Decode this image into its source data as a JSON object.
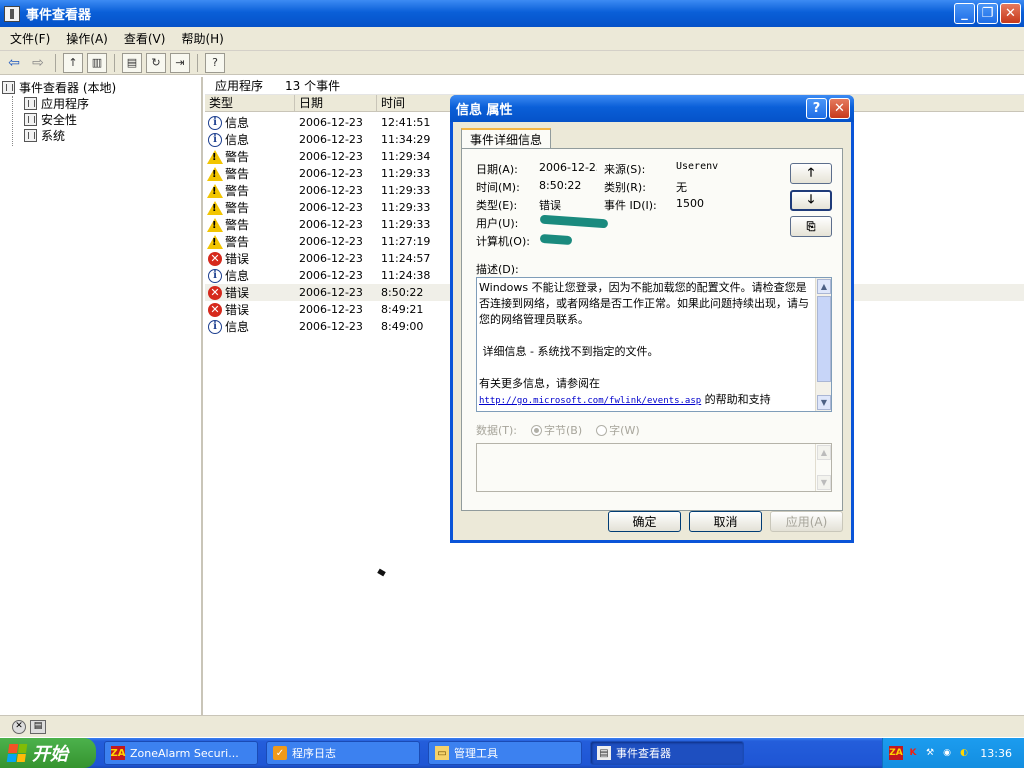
{
  "window": {
    "title": "事件查看器"
  },
  "menu": [
    "文件(F)",
    "操作(A)",
    "查看(V)",
    "帮助(H)"
  ],
  "tree": {
    "root": "事件查看器 (本地)",
    "children": [
      "应用程序",
      "安全性",
      "系统"
    ]
  },
  "list": {
    "header_name": "应用程序",
    "header_count": "13 个事件",
    "columns": [
      "类型",
      "日期",
      "时间"
    ],
    "rows": [
      {
        "type": "信息",
        "icon": "info-icon",
        "date": "2006-12-23",
        "time": "12:41:51"
      },
      {
        "type": "信息",
        "icon": "info-icon",
        "date": "2006-12-23",
        "time": "11:34:29"
      },
      {
        "type": "警告",
        "icon": "warning-icon",
        "date": "2006-12-23",
        "time": "11:29:34"
      },
      {
        "type": "警告",
        "icon": "warning-icon",
        "date": "2006-12-23",
        "time": "11:29:33"
      },
      {
        "type": "警告",
        "icon": "warning-icon",
        "date": "2006-12-23",
        "time": "11:29:33"
      },
      {
        "type": "警告",
        "icon": "warning-icon",
        "date": "2006-12-23",
        "time": "11:29:33"
      },
      {
        "type": "警告",
        "icon": "warning-icon",
        "date": "2006-12-23",
        "time": "11:29:33"
      },
      {
        "type": "警告",
        "icon": "warning-icon",
        "date": "2006-12-23",
        "time": "11:27:19"
      },
      {
        "type": "错误",
        "icon": "error-icon",
        "date": "2006-12-23",
        "time": "11:24:57"
      },
      {
        "type": "信息",
        "icon": "info-icon",
        "date": "2006-12-23",
        "time": "11:24:38"
      },
      {
        "type": "错误",
        "icon": "error-icon",
        "date": "2006-12-23",
        "time": "8:50:22",
        "selected": true
      },
      {
        "type": "错误",
        "icon": "error-icon",
        "date": "2006-12-23",
        "time": "8:49:21"
      },
      {
        "type": "信息",
        "icon": "info-icon",
        "date": "2006-12-23",
        "time": "8:49:00"
      }
    ]
  },
  "dialog": {
    "title": "信息 属性",
    "tab": "事件详细信息",
    "date_label": "日期(A):",
    "date_value": "2006-12-23",
    "source_label": "来源(S):",
    "source_value": "Userenv",
    "time_label": "时间(M):",
    "time_value": "8:50:22",
    "category_label": "类别(R):",
    "category_value": "无",
    "type_label": "类型(E):",
    "type_value": "错误",
    "event_id_label": "事件 ID(I):",
    "event_id_value": "1500",
    "user_label": "用户(U):",
    "computer_label": "计算机(O):",
    "desc_label": "描述(D):",
    "desc_text": "Windows 不能让您登录，因为不能加载您的配置文件。请检查您是否连接到网络，或者网络是否工作正常。如果此问题持续出现，请与您的网络管理员联系。\n\n 详细信息 - 系统找不到指定的文件。\n\n有关更多信息，请参阅在",
    "desc_link": "http://go.microsoft.com/fwlink/events.asp",
    "desc_after_link": " 的帮助和支持",
    "data_label": "数据(T):",
    "radio_bytes": "字节(B)",
    "radio_words": "字(W)",
    "ok": "确定",
    "cancel": "取消",
    "apply": "应用(A)"
  },
  "taskbar": {
    "start": "开始",
    "tasks": [
      "ZoneAlarm Securi...",
      "程序日志",
      "管理工具",
      "事件查看器"
    ],
    "clock": "13:36"
  },
  "colors": {
    "titlebar": "#0a5fd8",
    "taskbar": "#245edb",
    "start": "#35942f",
    "error": "#d6291c",
    "warning": "#f2c500"
  }
}
